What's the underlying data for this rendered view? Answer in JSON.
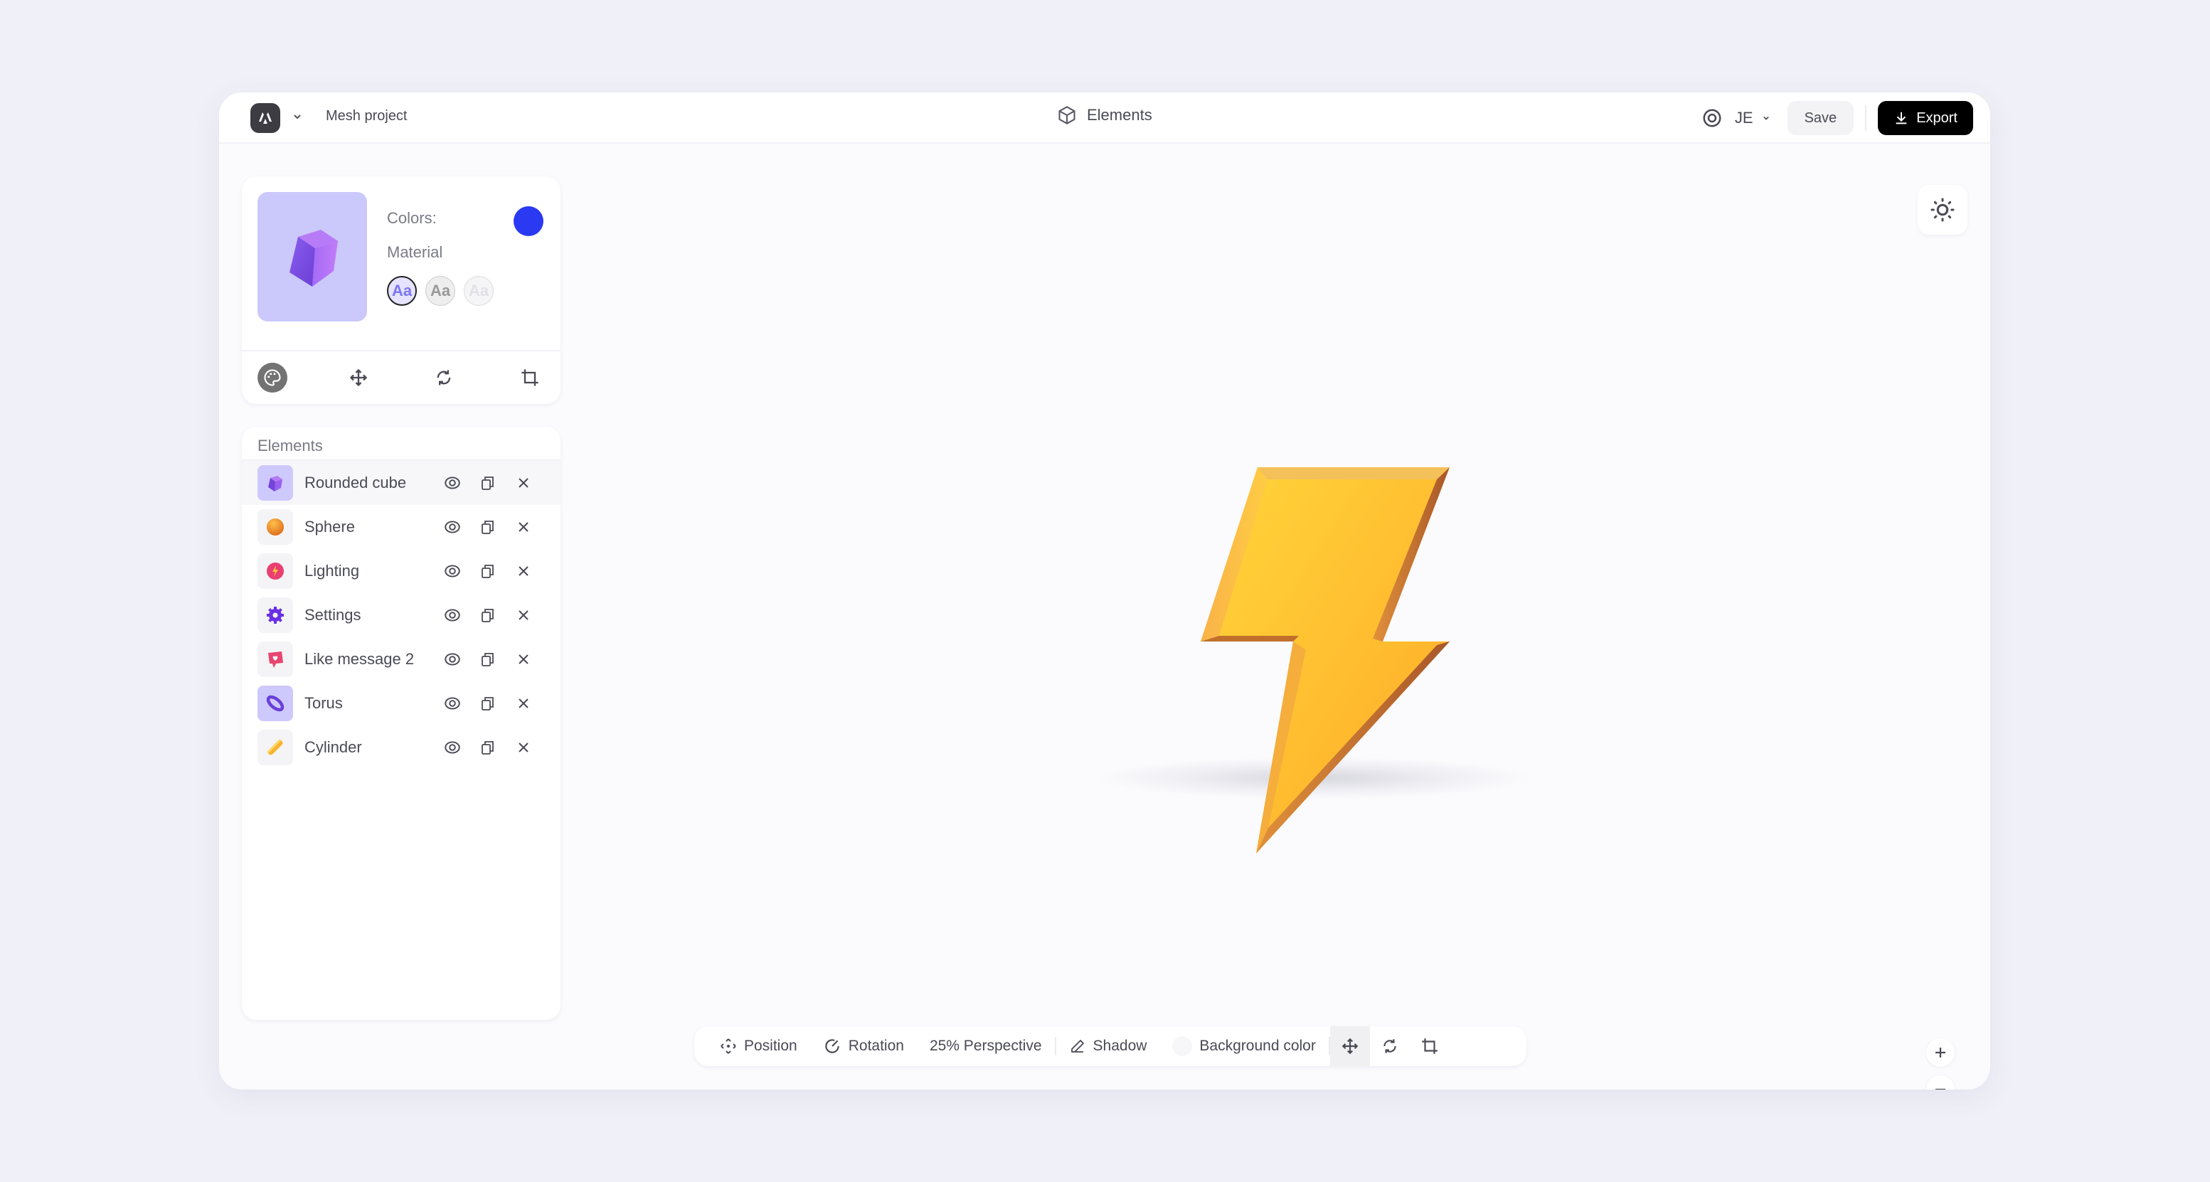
{
  "header": {
    "project_name": "Mesh project",
    "center_title": "Elements",
    "user_initials": "JE",
    "save_label": "Save",
    "export_label": "Export"
  },
  "material_panel": {
    "colors_label": "Colors:",
    "selected_color": "#2b39f2",
    "material_label": "Material",
    "materials": [
      {
        "glyph": "Aa",
        "style": "glossy",
        "selected": true
      },
      {
        "glyph": "Aa",
        "style": "metal",
        "selected": false
      },
      {
        "glyph": "Aa",
        "style": "glass",
        "selected": false
      }
    ],
    "tools": [
      "palette",
      "move",
      "rotate",
      "crop"
    ]
  },
  "elements_panel": {
    "title": "Elements",
    "items": [
      {
        "name": "Rounded cube",
        "icon": "cube-icon",
        "selected": true
      },
      {
        "name": "Sphere",
        "icon": "sphere-icon",
        "selected": false
      },
      {
        "name": "Lighting",
        "icon": "lightning-icon",
        "selected": false
      },
      {
        "name": "Settings",
        "icon": "gear-icon",
        "selected": false
      },
      {
        "name": "Like message 2",
        "icon": "like-message-icon",
        "selected": false
      },
      {
        "name": "Torus",
        "icon": "torus-icon",
        "selected": false
      },
      {
        "name": "Cylinder",
        "icon": "cylinder-icon",
        "selected": false
      }
    ]
  },
  "bottom_toolbar": {
    "position_label": "Position",
    "rotation_label": "Rotation",
    "perspective_label": "25% Perspective",
    "shadow_label": "Shadow",
    "background_label": "Background color",
    "active_tool": "move"
  },
  "canvas": {
    "object": "lightning-bolt",
    "object_color": "#ffb52e"
  }
}
